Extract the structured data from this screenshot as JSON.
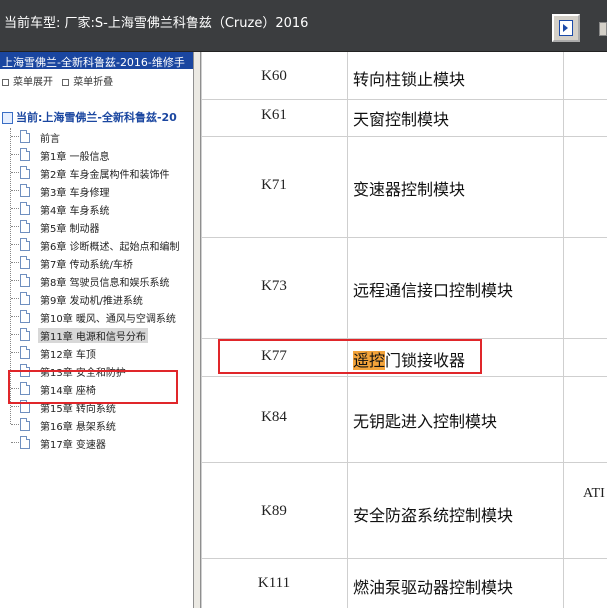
{
  "topbar": {
    "title": "当前车型:  厂家:S-上海雪佛兰科鲁兹（Cruze）2016",
    "toggle_icon": "toggle-panel-icon"
  },
  "sidebar": {
    "header": "上海雪佛兰-全新科鲁兹-2016-维修手",
    "expand_label": "菜单展开",
    "collapse_label": "菜单折叠",
    "current": "当前:上海雪佛兰-全新科鲁兹-20",
    "items": [
      {
        "label": "前言"
      },
      {
        "label": "第1章 一般信息"
      },
      {
        "label": "第2章 车身金属构件和装饰件"
      },
      {
        "label": "第3章 车身修理"
      },
      {
        "label": "第4章 车身系统"
      },
      {
        "label": "第5章 制动器"
      },
      {
        "label": "第6章 诊断概述、起始点和编制"
      },
      {
        "label": "第7章 传动系统/车桥"
      },
      {
        "label": "第8章 驾驶员信息和娱乐系统"
      },
      {
        "label": "第9章 发动机/推进系统"
      },
      {
        "label": "第10章 暖风、通风与空调系统"
      },
      {
        "label": "第11章 电源和信号分布"
      },
      {
        "label": "第12章 车顶"
      },
      {
        "label": "第13章 安全和防护"
      },
      {
        "label": "第14章 座椅"
      },
      {
        "label": "第15章 转向系统"
      },
      {
        "label": "第16章 悬架系统"
      },
      {
        "label": "第17章 变速器"
      }
    ]
  },
  "table": {
    "rows": [
      {
        "code": "K60",
        "name": "转向柱锁止模块"
      },
      {
        "code": "K61",
        "name": "天窗控制模块"
      },
      {
        "code": "K71",
        "name": "变速器控制模块"
      },
      {
        "code": "K73",
        "name": "远程通信接口控制模块"
      },
      {
        "code": "K77",
        "name_highlight": "遥控",
        "name_rest": "门锁接收器"
      },
      {
        "code": "K84",
        "name": "无钥匙进入控制模块"
      },
      {
        "code": "K89",
        "name": "安全防盗系统控制模块",
        "extra": "ATI"
      },
      {
        "code": "K111",
        "name": "燃油泵驱动器控制模块"
      }
    ]
  },
  "colors": {
    "highlight": "#f3a33a",
    "annotation_box": "#e0262a",
    "sidebar_header": "#1a46a0"
  }
}
